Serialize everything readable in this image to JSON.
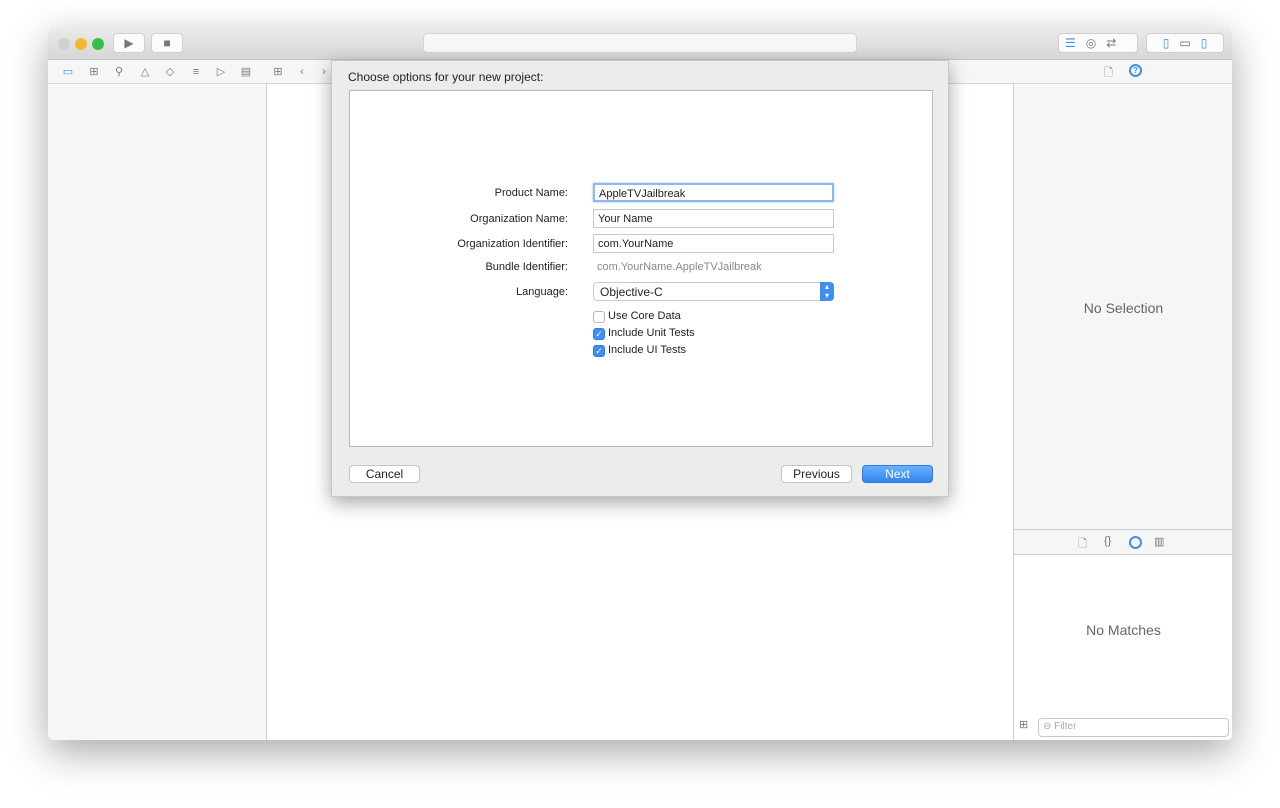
{
  "toolbar": {
    "run_icon": "play-icon",
    "stop_icon": "stop-icon"
  },
  "navigator_icons": [
    "folder-icon",
    "hierarchy-icon",
    "search-icon",
    "warning-icon",
    "diamond-icon",
    "list-icon",
    "tag-icon",
    "comment-icon"
  ],
  "dialog": {
    "title": "Choose options for your new project:",
    "fields": {
      "product_name_label": "Product Name:",
      "product_name": "AppleTVJailbreak",
      "org_name_label": "Organization Name:",
      "org_name": "Your Name",
      "org_id_label": "Organization Identifier:",
      "org_id": "com.YourName",
      "bundle_id_label": "Bundle Identifier:",
      "bundle_id": "com.YourName.AppleTVJailbreak",
      "language_label": "Language:",
      "language": "Objective-C"
    },
    "checkboxes": [
      {
        "label": "Use Core Data",
        "checked": false
      },
      {
        "label": "Include Unit Tests",
        "checked": true
      },
      {
        "label": "Include UI Tests",
        "checked": true
      }
    ],
    "cancel": "Cancel",
    "previous": "Previous",
    "next": "Next"
  },
  "inspector": {
    "no_selection": "No Selection",
    "no_matches": "No Matches",
    "filter_placeholder": "Filter"
  },
  "colors": {
    "accent": "#3d8ff2"
  }
}
